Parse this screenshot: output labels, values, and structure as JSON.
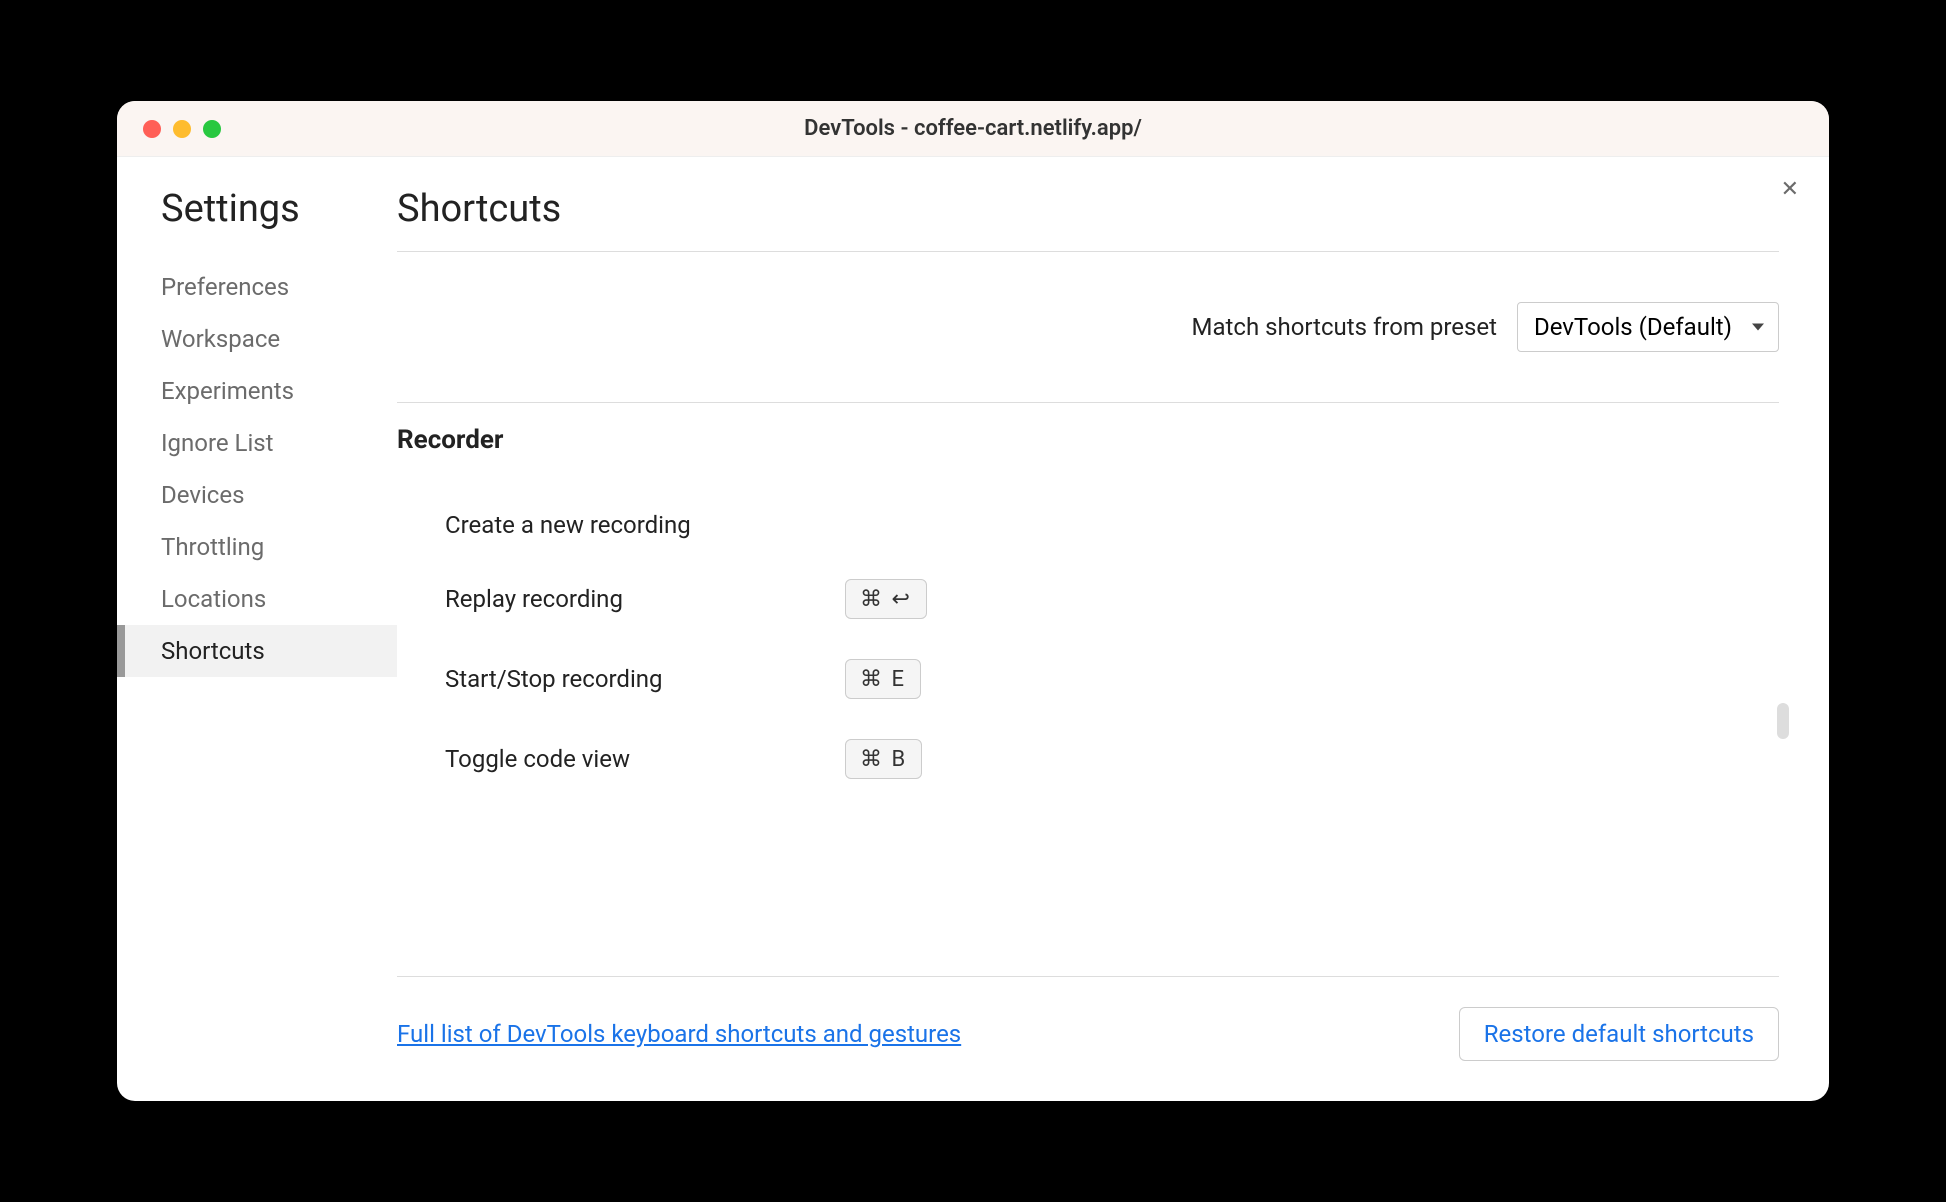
{
  "window": {
    "title": "DevTools - coffee-cart.netlify.app/"
  },
  "sidebar": {
    "title": "Settings",
    "items": [
      {
        "label": "Preferences",
        "active": false
      },
      {
        "label": "Workspace",
        "active": false
      },
      {
        "label": "Experiments",
        "active": false
      },
      {
        "label": "Ignore List",
        "active": false
      },
      {
        "label": "Devices",
        "active": false
      },
      {
        "label": "Throttling",
        "active": false
      },
      {
        "label": "Locations",
        "active": false
      },
      {
        "label": "Shortcuts",
        "active": true
      }
    ]
  },
  "page": {
    "title": "Shortcuts",
    "preset_label": "Match shortcuts from preset",
    "preset_value": "DevTools (Default)",
    "section_title": "Recorder",
    "shortcuts": [
      {
        "label": "Create a new recording",
        "keys": ""
      },
      {
        "label": "Replay recording",
        "keys": "⌘ ↩"
      },
      {
        "label": "Start/Stop recording",
        "keys": "⌘ E"
      },
      {
        "label": "Toggle code view",
        "keys": "⌘ B"
      }
    ],
    "footer_link": "Full list of DevTools keyboard shortcuts and gestures",
    "restore_button": "Restore default shortcuts",
    "close_label": "✕"
  }
}
